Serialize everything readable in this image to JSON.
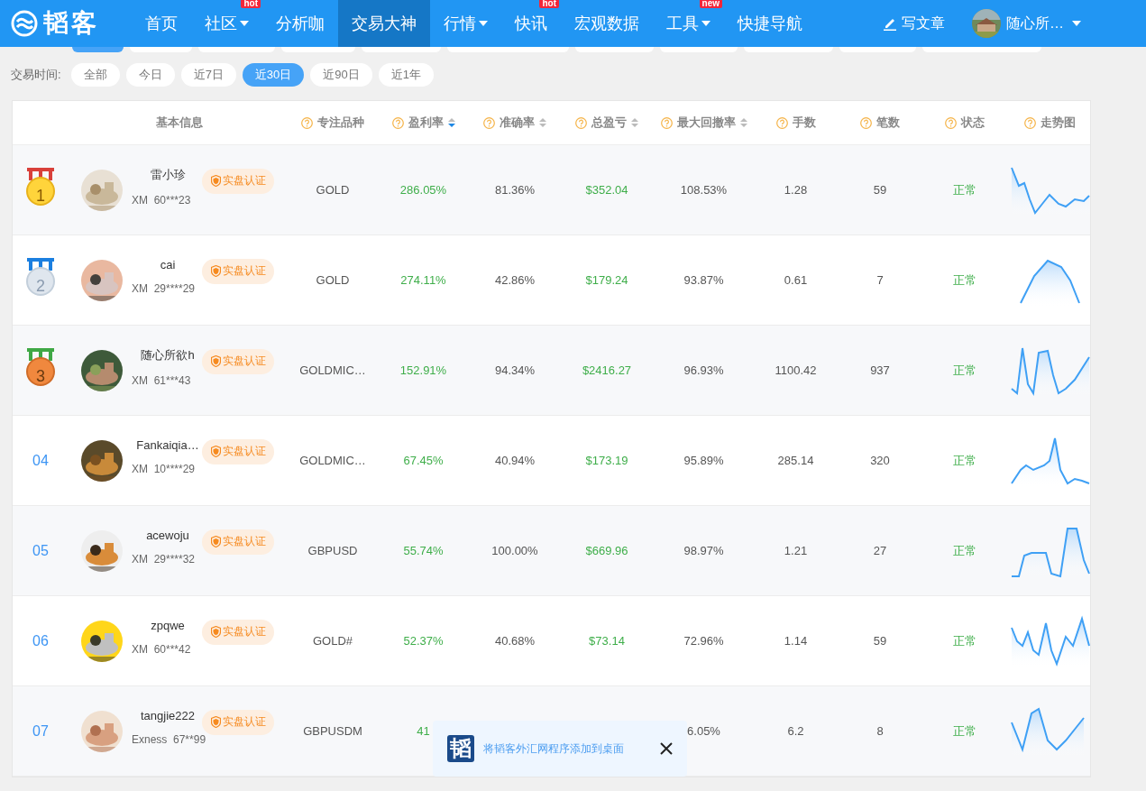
{
  "nav": {
    "logo": "韬客",
    "items": [
      {
        "label": "首页",
        "selected": false,
        "dropdown": false
      },
      {
        "label": "社区",
        "selected": false,
        "dropdown": true,
        "badge": "hot"
      },
      {
        "label": "分析咖",
        "selected": false,
        "dropdown": false
      },
      {
        "label": "交易大神",
        "selected": true,
        "dropdown": false
      },
      {
        "label": "行情",
        "selected": false,
        "dropdown": true
      },
      {
        "label": "快讯",
        "selected": false,
        "dropdown": false,
        "badge": "hot"
      },
      {
        "label": "宏观数据",
        "selected": false,
        "dropdown": false
      },
      {
        "label": "工具",
        "selected": false,
        "dropdown": true,
        "badge": "new"
      },
      {
        "label": "快捷导航",
        "selected": false,
        "dropdown": false
      }
    ],
    "write": "写文章",
    "user": "随心所…"
  },
  "hidden_filters": [
    {
      "selected": true
    },
    {
      "selected": false
    },
    {
      "selected": false
    },
    {
      "selected": false
    },
    {
      "selected": false
    },
    {
      "selected": false
    },
    {
      "selected": false
    },
    {
      "selected": false
    },
    {
      "selected": false
    },
    {
      "selected": false
    },
    {
      "selected": false
    }
  ],
  "time_filter": {
    "label": "交易时间:",
    "options": [
      {
        "label": "全部",
        "selected": false
      },
      {
        "label": "今日",
        "selected": false
      },
      {
        "label": "近7日",
        "selected": false
      },
      {
        "label": "近30日",
        "selected": true
      },
      {
        "label": "近90日",
        "selected": false
      },
      {
        "label": "近1年",
        "selected": false
      }
    ]
  },
  "table": {
    "columns": [
      {
        "label": "基本信息",
        "help": false,
        "sortable": false
      },
      {
        "label": "专注品种",
        "help": true,
        "sortable": false
      },
      {
        "label": "盈利率",
        "help": true,
        "sortable": true,
        "sorted_desc": true
      },
      {
        "label": "准确率",
        "help": true,
        "sortable": true,
        "sorted_desc": false
      },
      {
        "label": "总盈亏",
        "help": true,
        "sortable": true,
        "sorted_desc": false
      },
      {
        "label": "最大回撤率",
        "help": true,
        "sortable": true,
        "sorted_desc": false
      },
      {
        "label": "手数",
        "help": true,
        "sortable": false
      },
      {
        "label": "笔数",
        "help": true,
        "sortable": false
      },
      {
        "label": "状态",
        "help": true,
        "sortable": false
      },
      {
        "label": "走势图",
        "help": true,
        "sortable": false
      }
    ],
    "rows": [
      {
        "rank": "1",
        "kind": "gold",
        "name": "雷小珍",
        "account": "XM  60***23",
        "badge": "实盘认证",
        "symbol": "GOLD",
        "profit_rate": "286.05%",
        "accuracy": "81.36%",
        "total": "$352.04",
        "drawdown": "108.53%",
        "lots": "1.28",
        "trades": "59",
        "status": "正常"
      },
      {
        "rank": "2",
        "kind": "silver",
        "name": "cai",
        "account": "XM  29****29",
        "badge": "实盘认证",
        "symbol": "GOLD",
        "profit_rate": "274.11%",
        "accuracy": "42.86%",
        "total": "$179.24",
        "drawdown": "93.87%",
        "lots": "0.61",
        "trades": "7",
        "status": "正常"
      },
      {
        "rank": "3",
        "kind": "bronze",
        "name": "随心所欲h",
        "account": "XM  61***43",
        "badge": "实盘认证",
        "symbol": "GOLDMIC…",
        "profit_rate": "152.91%",
        "accuracy": "94.34%",
        "total": "$2416.27",
        "drawdown": "96.93%",
        "lots": "1100.42",
        "trades": "937",
        "status": "正常"
      },
      {
        "rank": "04",
        "kind": "plain",
        "name": "Fankaiqia…",
        "account": "XM  10****29",
        "badge": "实盘认证",
        "symbol": "GOLDMIC…",
        "profit_rate": "67.45%",
        "accuracy": "40.94%",
        "total": "$173.19",
        "drawdown": "95.89%",
        "lots": "285.14",
        "trades": "320",
        "status": "正常"
      },
      {
        "rank": "05",
        "kind": "plain",
        "name": "acewoju",
        "account": "XM  29****32",
        "badge": "实盘认证",
        "symbol": "GBPUSD",
        "profit_rate": "55.74%",
        "accuracy": "100.00%",
        "total": "$669.96",
        "drawdown": "98.97%",
        "lots": "1.21",
        "trades": "27",
        "status": "正常"
      },
      {
        "rank": "06",
        "kind": "plain",
        "name": "zpqwe",
        "account": "XM  60***42",
        "badge": "实盘认证",
        "symbol": "GOLD#",
        "profit_rate": "52.37%",
        "accuracy": "40.68%",
        "total": "$73.14",
        "drawdown": "72.96%",
        "lots": "1.14",
        "trades": "59",
        "status": "正常"
      },
      {
        "rank": "07",
        "kind": "plain",
        "name": "tangjie222",
        "account": "Exness  67**99",
        "badge": "实盘认证",
        "symbol": "GBPUSDM",
        "profit_rate": "41",
        "drawdown": "6.05%",
        "lots": "6.2",
        "trades": "8",
        "status": "正常"
      }
    ]
  },
  "popup": {
    "logo": "韬",
    "message": "将韬客外汇网程序添加到桌面"
  }
}
